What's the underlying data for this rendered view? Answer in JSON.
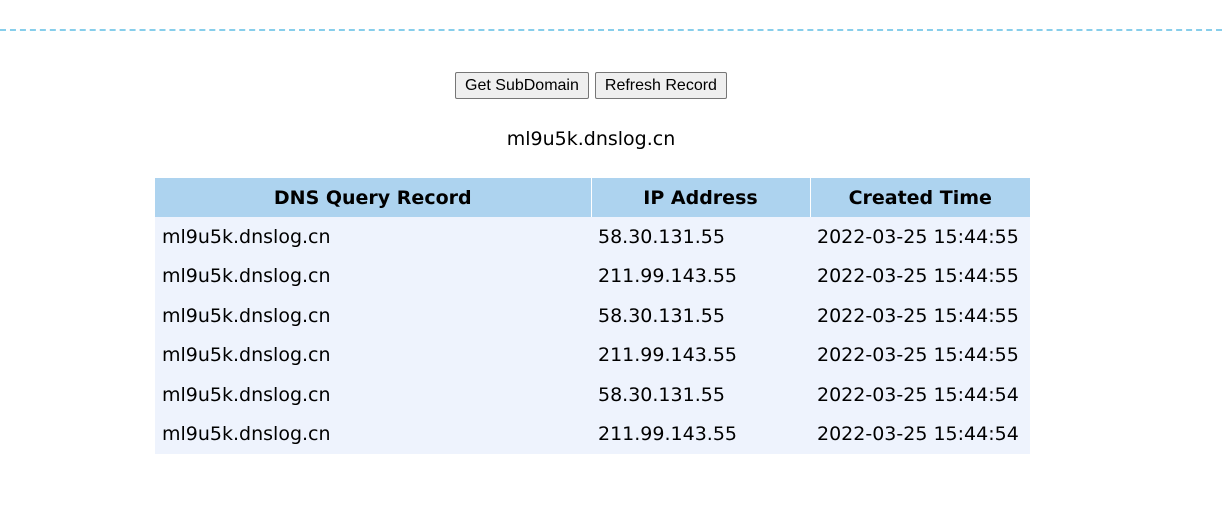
{
  "toolbar": {
    "get_subdomain_label": "Get SubDomain",
    "refresh_record_label": "Refresh Record"
  },
  "subdomain": "ml9u5k.dnslog.cn",
  "table": {
    "headers": [
      "DNS Query Record",
      "IP Address",
      "Created Time"
    ],
    "rows": [
      [
        "ml9u5k.dnslog.cn",
        "58.30.131.55",
        "2022-03-25 15:44:55"
      ],
      [
        "ml9u5k.dnslog.cn",
        "211.99.143.55",
        "2022-03-25 15:44:55"
      ],
      [
        "ml9u5k.dnslog.cn",
        "58.30.131.55",
        "2022-03-25 15:44:55"
      ],
      [
        "ml9u5k.dnslog.cn",
        "211.99.143.55",
        "2022-03-25 15:44:55"
      ],
      [
        "ml9u5k.dnslog.cn",
        "58.30.131.55",
        "2022-03-25 15:44:54"
      ],
      [
        "ml9u5k.dnslog.cn",
        "211.99.143.55",
        "2022-03-25 15:44:54"
      ]
    ]
  },
  "colors": {
    "divider": "#87ceeb",
    "header_bg": "#add3ef",
    "row_bg": "#eef3fd"
  }
}
